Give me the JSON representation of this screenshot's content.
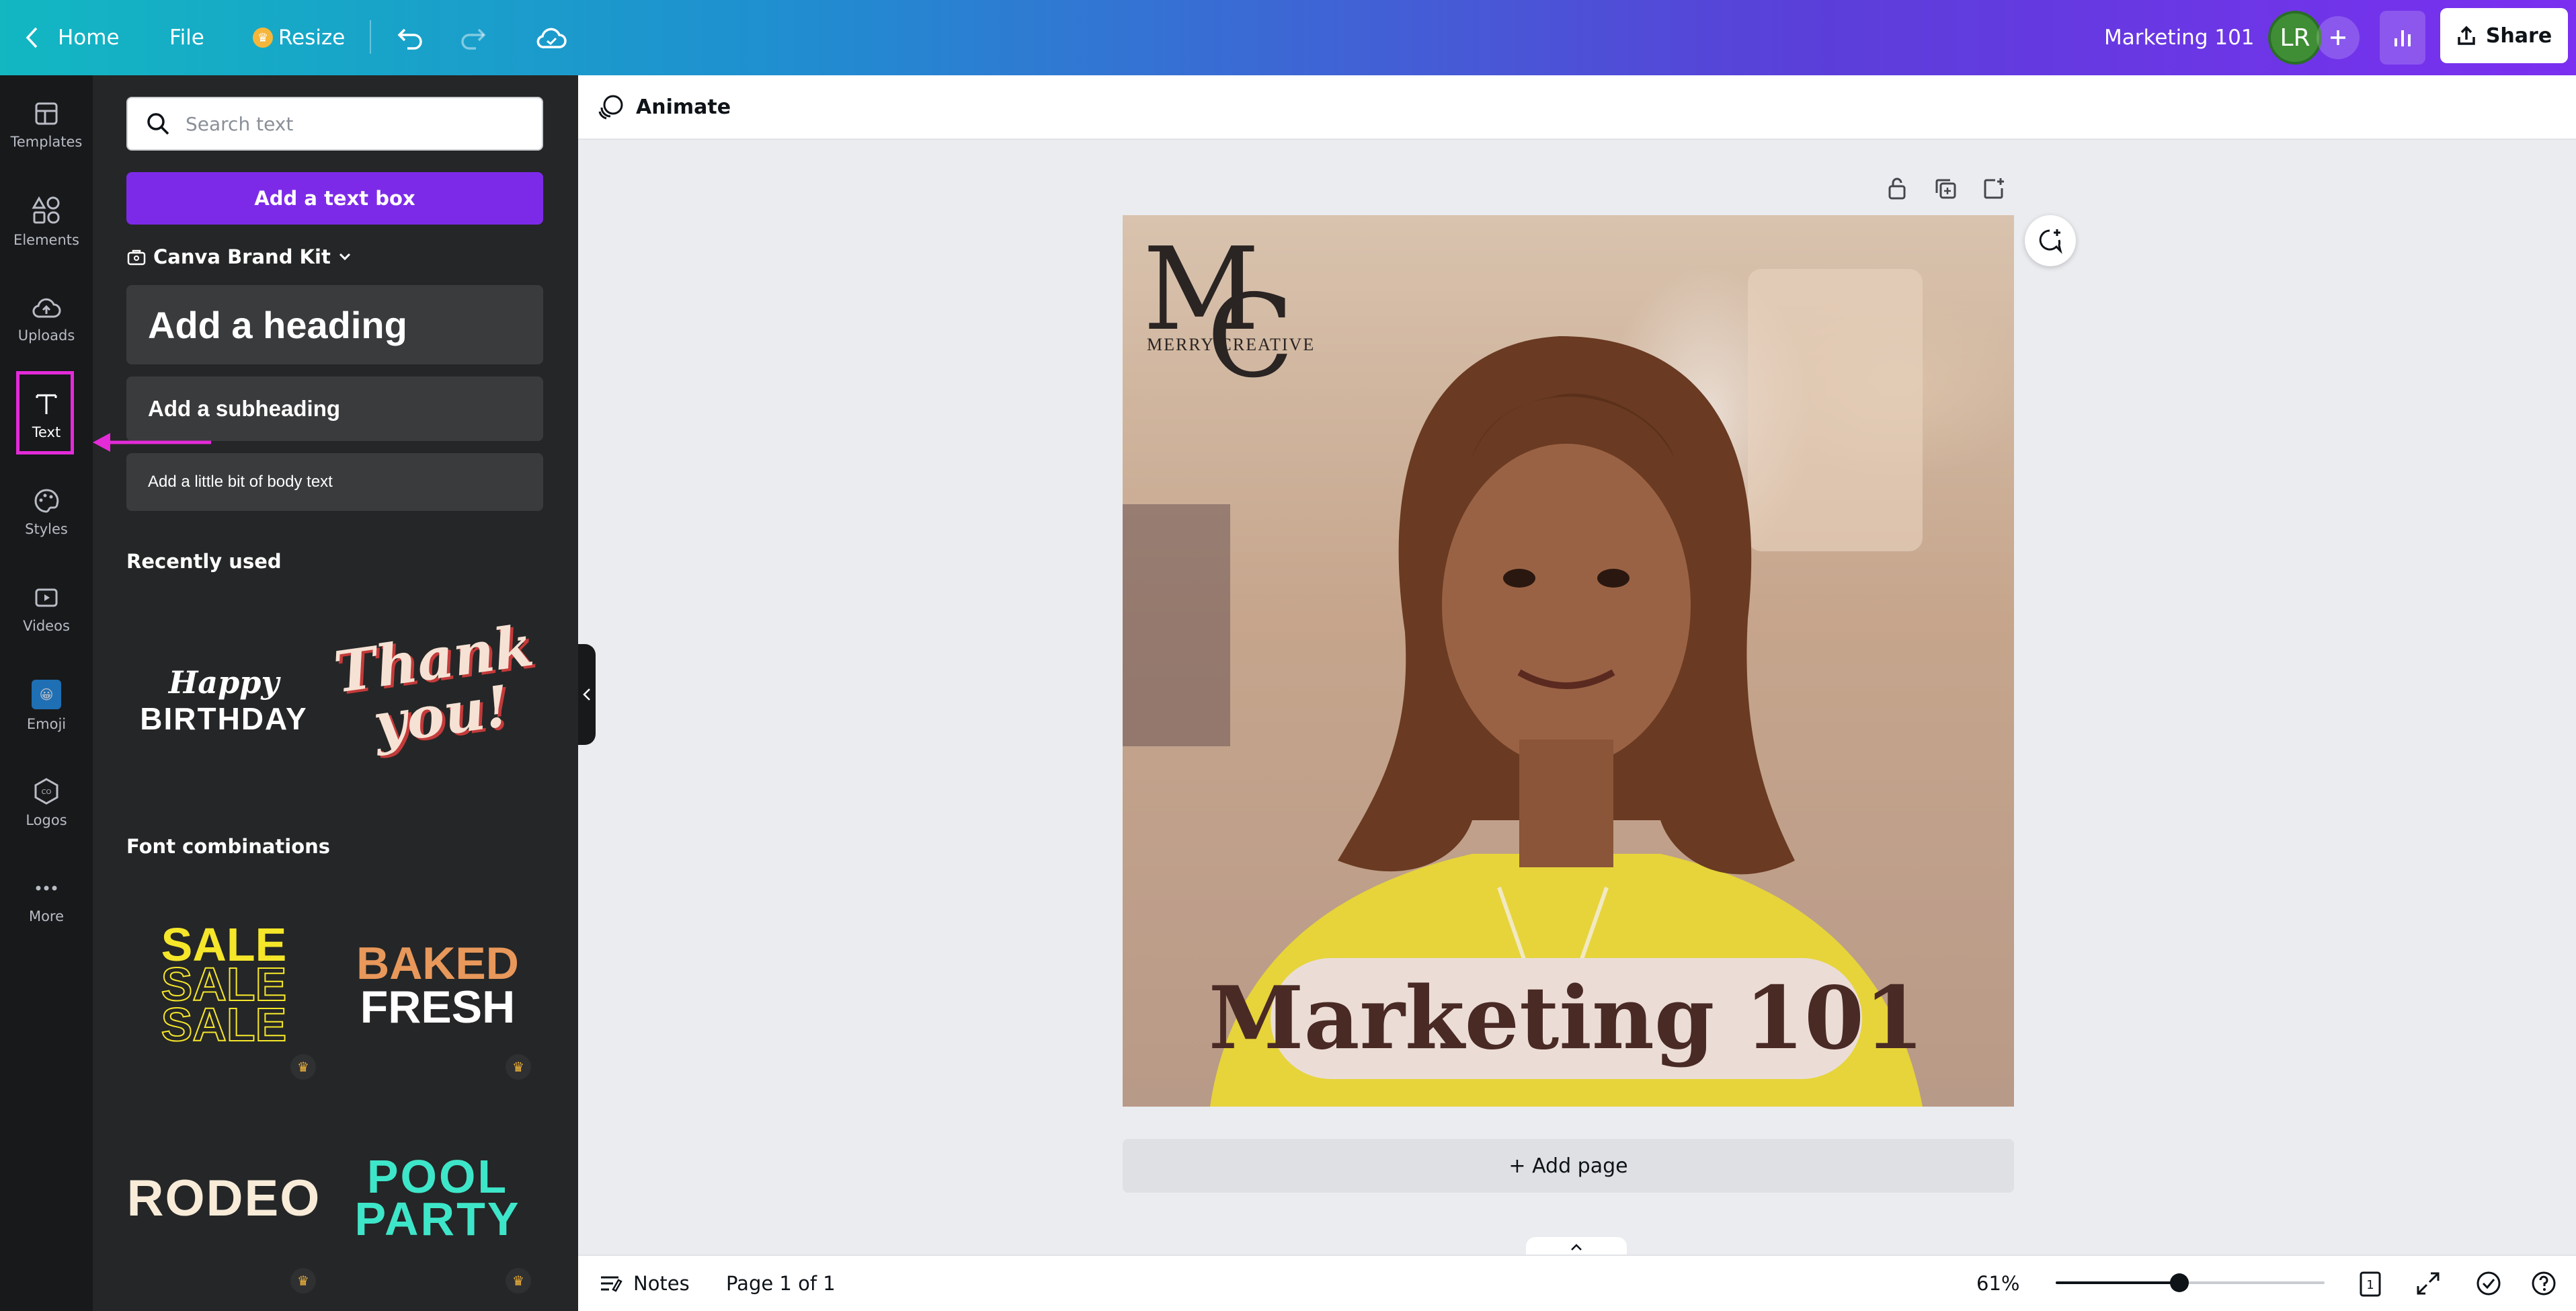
{
  "topbar": {
    "home_label": "Home",
    "file_label": "File",
    "resize_label": "Resize",
    "design_title": "Marketing 101",
    "avatar_initials": "LR",
    "share_label": "Share"
  },
  "rail": {
    "items": [
      {
        "label": "Templates"
      },
      {
        "label": "Elements"
      },
      {
        "label": "Uploads"
      },
      {
        "label": "Text"
      },
      {
        "label": "Styles"
      },
      {
        "label": "Videos"
      },
      {
        "label": "Emoji"
      },
      {
        "label": "Logos"
      },
      {
        "label": "More"
      }
    ],
    "active": "Text"
  },
  "panel": {
    "search_placeholder": "Search text",
    "add_textbox_label": "Add a text box",
    "brand_kit_label": "Canva Brand Kit",
    "heading_label": "Add a heading",
    "subheading_label": "Add a subheading",
    "body_label": "Add a little bit of body text",
    "recently_used_title": "Recently used",
    "recent": {
      "happy": "Happy",
      "birthday": "BIRTHDAY",
      "thank": "Thank",
      "you": "you!"
    },
    "font_combinations_title": "Font combinations",
    "combos": {
      "sale": "SALE",
      "baked": "BAKED",
      "fresh": "FRESH",
      "rodeo": "RODEO",
      "pool": "POOL",
      "party": "PARTY"
    }
  },
  "toolbar": {
    "animate_label": "Animate"
  },
  "design": {
    "logo_letters_m": "M",
    "logo_letters_c": "C",
    "logo_text": "MERRY CREATIVE",
    "headline": "Marketing 101"
  },
  "canvas": {
    "add_page_label": "+ Add page"
  },
  "bottombar": {
    "notes_label": "Notes",
    "page_label": "Page 1 of 1",
    "zoom_label": "61%",
    "zoom_level": 0.46,
    "page_count": "1"
  },
  "colors": {
    "accent_purple": "#7D2AE8",
    "highlight_magenta": "#E32BD8",
    "headline_text": "#4A2A25"
  }
}
